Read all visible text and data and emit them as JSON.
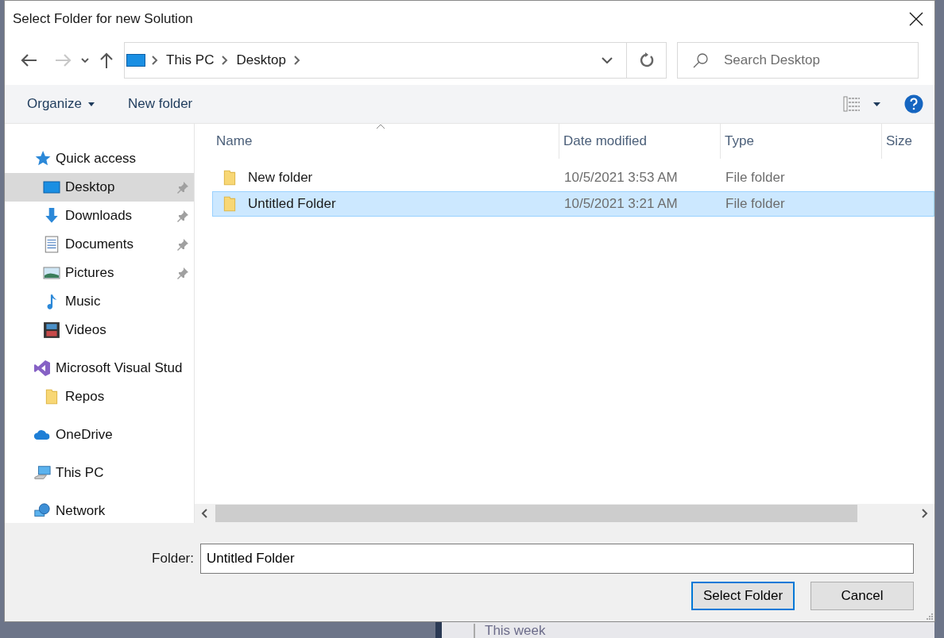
{
  "window": {
    "title": "Select Folder for new Solution"
  },
  "address": {
    "crumbs": [
      "This PC",
      "Desktop"
    ]
  },
  "search": {
    "placeholder": "Search Desktop"
  },
  "toolbar": {
    "organize": "Organize",
    "new_folder": "New folder"
  },
  "sidebar": {
    "items": [
      {
        "label": "Quick access",
        "kind": "star",
        "selected": false,
        "children": [
          {
            "label": "Desktop",
            "kind": "desktop",
            "selected": true,
            "pinned": true
          },
          {
            "label": "Downloads",
            "kind": "download",
            "selected": false,
            "pinned": true
          },
          {
            "label": "Documents",
            "kind": "document",
            "selected": false,
            "pinned": true
          },
          {
            "label": "Pictures",
            "kind": "pictures",
            "selected": false,
            "pinned": true
          },
          {
            "label": "Music",
            "kind": "music",
            "selected": false,
            "pinned": false
          },
          {
            "label": "Videos",
            "kind": "video",
            "selected": false,
            "pinned": false
          }
        ]
      },
      {
        "label": "Microsoft Visual Stud",
        "kind": "vs",
        "selected": false,
        "children": [
          {
            "label": "Repos",
            "kind": "folder",
            "selected": false,
            "pinned": false
          }
        ]
      },
      {
        "label": "OneDrive",
        "kind": "cloud",
        "selected": false
      },
      {
        "label": "This PC",
        "kind": "pc",
        "selected": false
      },
      {
        "label": "Network",
        "kind": "network",
        "selected": false
      }
    ]
  },
  "table": {
    "columns": [
      "Name",
      "Date modified",
      "Type",
      "Size"
    ],
    "rows": [
      {
        "name": "New folder",
        "date": "10/5/2021 3:53 AM",
        "type": "File folder",
        "selected": false
      },
      {
        "name": "Untitled Folder",
        "date": "10/5/2021 3:21 AM",
        "type": "File folder",
        "selected": true
      }
    ]
  },
  "folder_field": {
    "label": "Folder:",
    "value": "Untitled Folder"
  },
  "buttons": [
    {
      "label": "Select Folder",
      "kind": "primary"
    },
    {
      "label": "Cancel",
      "kind": "normal"
    }
  ],
  "background": {
    "text": "This week"
  }
}
